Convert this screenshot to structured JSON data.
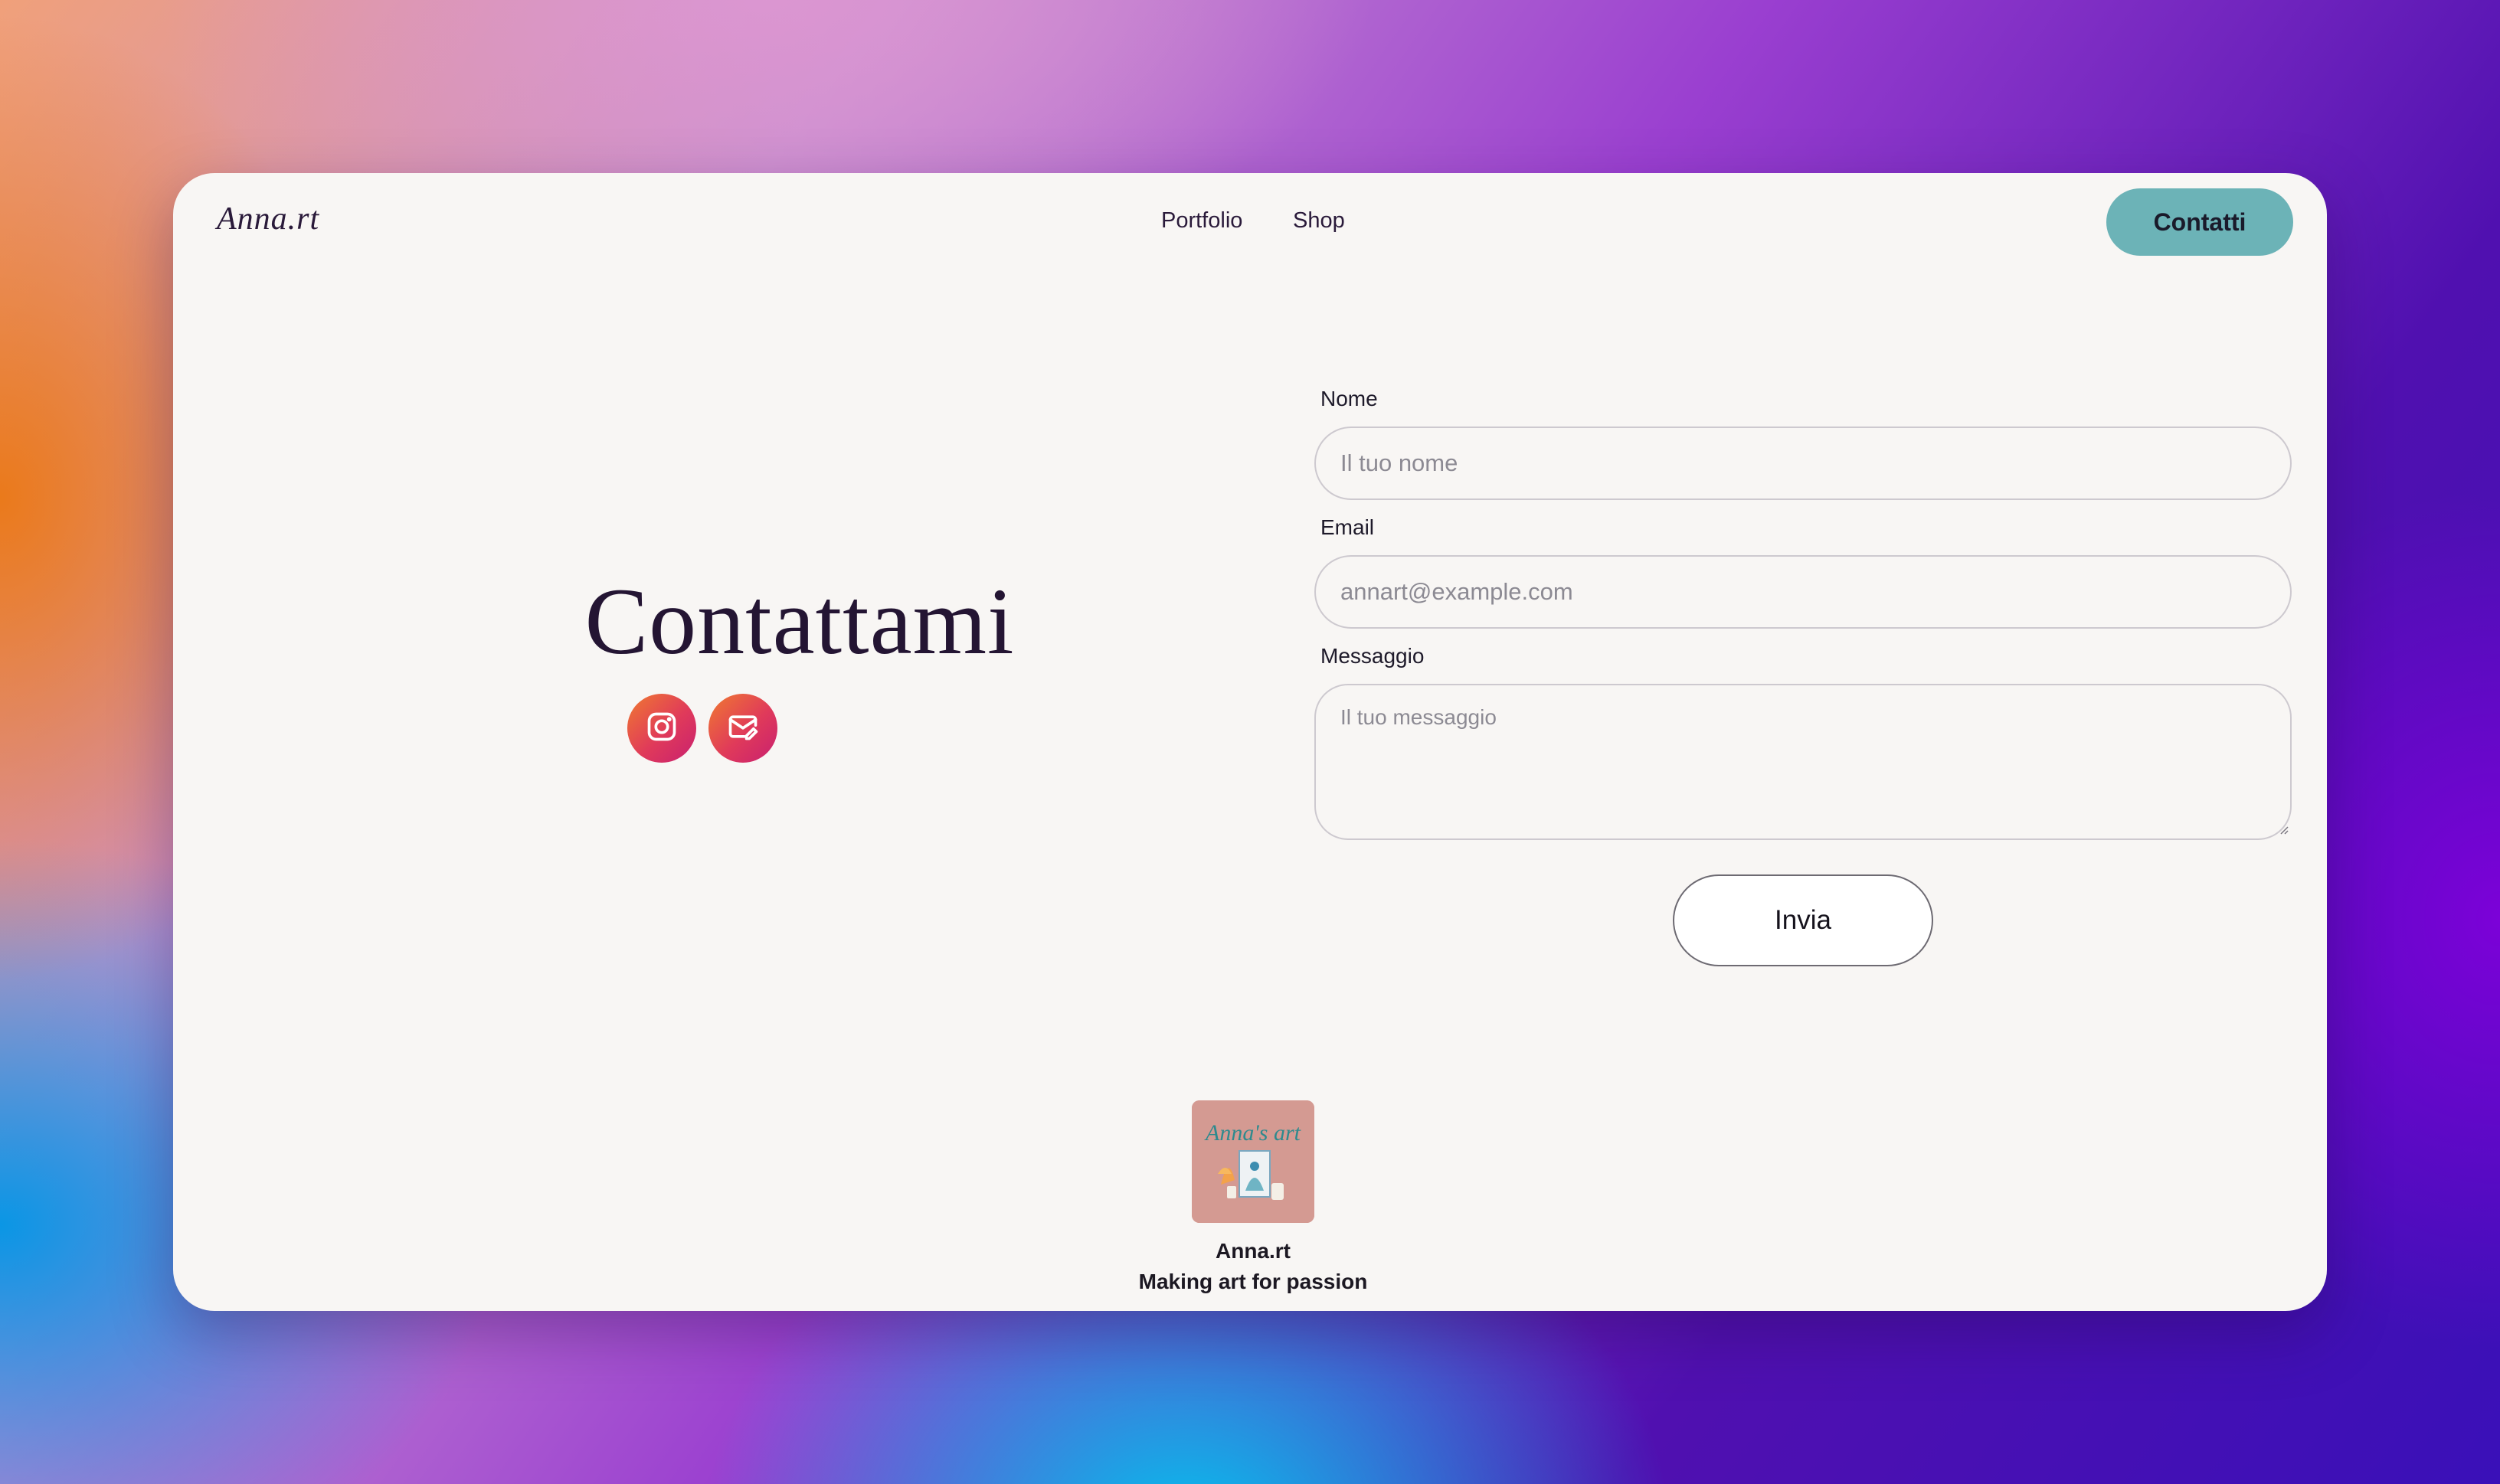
{
  "header": {
    "logo": "Anna.rt",
    "nav": [
      {
        "label": "Portfolio"
      },
      {
        "label": "Shop"
      }
    ],
    "cta_label": "Contatti",
    "cta_color": "#6cb3b7"
  },
  "hero": {
    "title": "Contattami",
    "social_links": [
      {
        "icon": "instagram-icon"
      },
      {
        "icon": "mail-edit-icon"
      }
    ]
  },
  "form": {
    "name_label": "Nome",
    "name_placeholder": "Il tuo nome",
    "email_label": "Email",
    "email_placeholder": "annart@example.com",
    "message_label": "Messaggio",
    "message_placeholder": "Il tuo messaggio",
    "submit_label": "Invia"
  },
  "footer": {
    "logo_text": "Anna's art",
    "name": "Anna.rt",
    "tagline": "Making art for passion"
  }
}
